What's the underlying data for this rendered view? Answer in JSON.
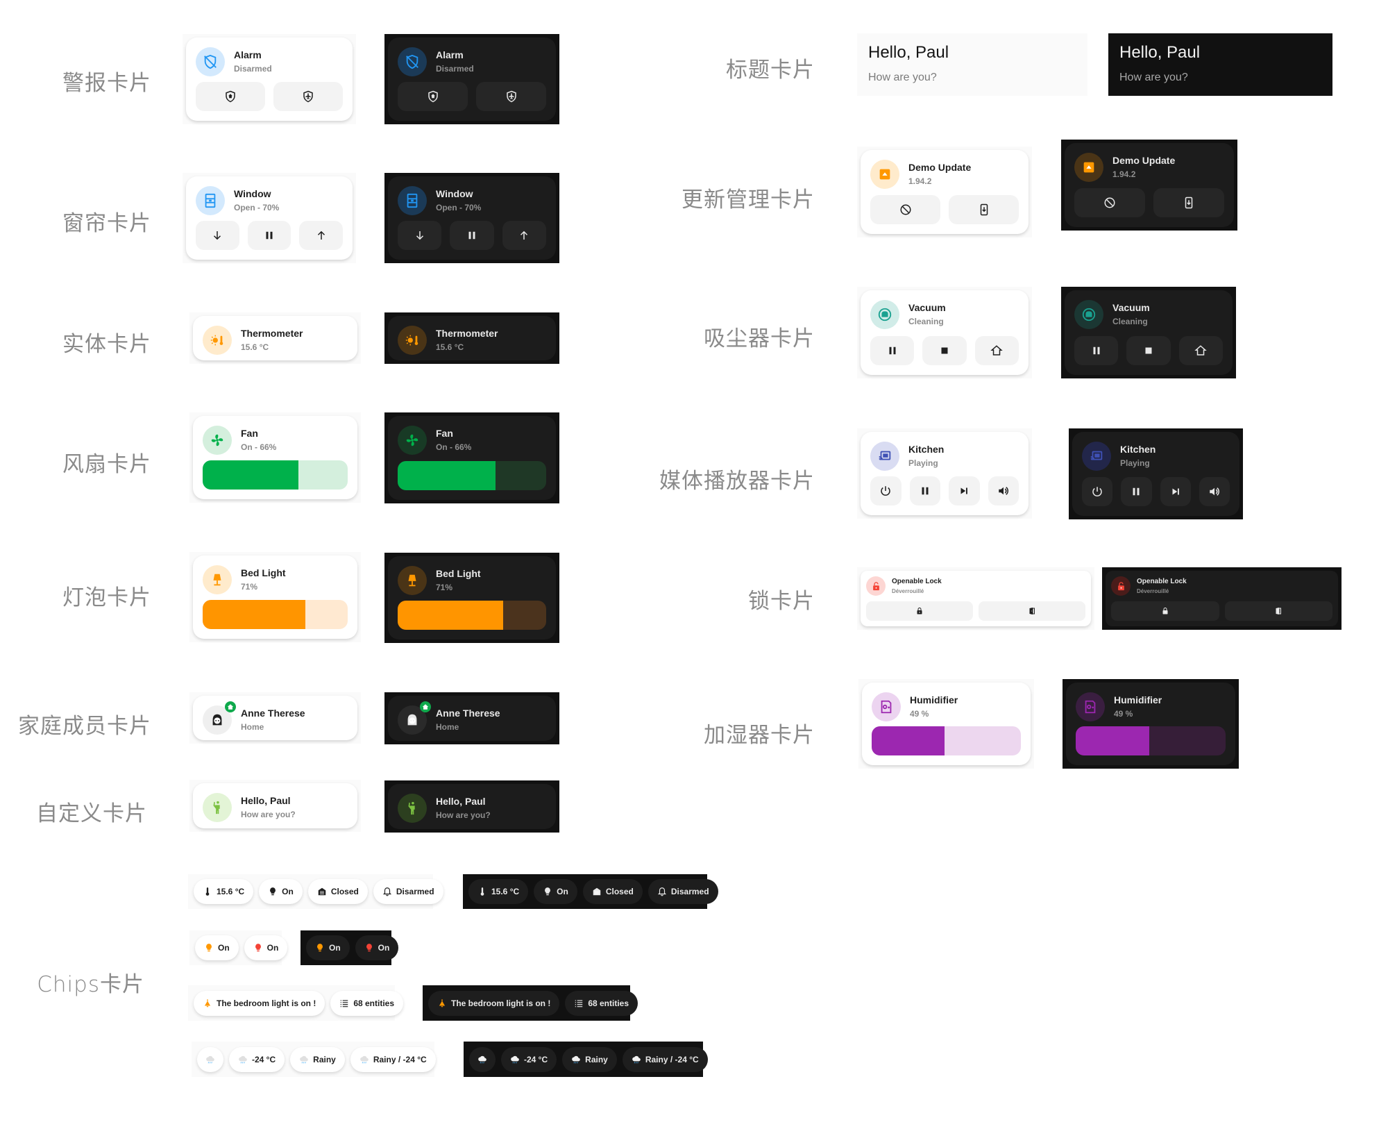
{
  "labels": {
    "alarm": "警报卡片",
    "cover": "窗帘卡片",
    "entity": "实体卡片",
    "fan": "风扇卡片",
    "light": "灯泡卡片",
    "person": "家庭成员卡片",
    "template": "自定义卡片",
    "chips": "Chips卡片",
    "title": "标题卡片",
    "update": "更新管理卡片",
    "vacuum": "吸尘器卡片",
    "media": "媒体播放器卡片",
    "lock": "锁卡片",
    "humidifier": "加湿器卡片"
  },
  "colors": {
    "alarm_blue": "#2196f3",
    "orange": "#ff9800",
    "green": "#00b14b",
    "teal": "#1aa190",
    "indigo": "#3f51b5",
    "red": "#f44336",
    "purple": "#9c27b0",
    "lightgreen": "#7cc142"
  },
  "alarm": {
    "name": "Alarm",
    "state": "Disarmed",
    "icon": "shield-off-icon",
    "buttons": [
      "shield-home-icon",
      "shield-airplane-icon"
    ]
  },
  "cover": {
    "name": "Window",
    "state": "Open - 70%",
    "icon": "window-icon",
    "buttons": [
      "arrow-down-icon",
      "pause-icon",
      "arrow-up-icon"
    ]
  },
  "entity": {
    "name": "Thermometer",
    "state": "15.6 °C",
    "icon": "thermometer-sun-icon"
  },
  "fan": {
    "name": "Fan",
    "state": "On - 66%",
    "icon": "fan-icon",
    "percentage": 66
  },
  "light": {
    "name": "Bed Light",
    "state": "71%",
    "icon": "lamp-icon",
    "brightness": 71
  },
  "person": {
    "name": "Anne Therese",
    "state": "Home",
    "icon": "face-woman-icon",
    "badge": "home-icon"
  },
  "template": {
    "name": "Hello, Paul",
    "state": "How are you?",
    "icon": "human-greeting-icon"
  },
  "title": {
    "title": "Hello, Paul",
    "subtitle": "How are you?"
  },
  "update": {
    "name": "Demo Update",
    "state": "1.94.2",
    "icon": "package-up-icon",
    "buttons": [
      "cancel-icon",
      "cellphone-arrow-down-icon"
    ]
  },
  "vacuum": {
    "name": "Vacuum",
    "state": "Cleaning",
    "icon": "robot-vacuum-icon",
    "buttons": [
      "pause-icon",
      "stop-icon",
      "home-map-marker-icon"
    ]
  },
  "media": {
    "name": "Kitchen",
    "state": "Playing",
    "icon": "cast-icon",
    "buttons": [
      "power-icon",
      "pause-icon",
      "skip-next-icon",
      "volume-icon"
    ]
  },
  "lock": {
    "name": "Openable Lock",
    "state": "Déverrouillé",
    "icon": "lock-open-icon",
    "buttons": [
      "lock-icon",
      "door-open-icon"
    ]
  },
  "humidifier": {
    "name": "Humidifier",
    "state": "49 %",
    "icon": "air-humidifier-icon",
    "humidity": 49
  },
  "chips": {
    "row1": [
      {
        "icon": "thermometer-icon",
        "label": "15.6 °C"
      },
      {
        "icon": "lightbulb-icon",
        "label": "On"
      },
      {
        "icon": "garage-icon",
        "label": "Closed"
      },
      {
        "icon": "bell-icon",
        "label": "Disarmed"
      }
    ],
    "row2": [
      {
        "icon": "lightbulb-orange-icon",
        "label": "On"
      },
      {
        "icon": "lightbulb-red-icon",
        "label": "On"
      }
    ],
    "row3": [
      {
        "icon": "ceiling-light-icon",
        "label": "The bedroom light is on !"
      },
      {
        "icon": "list-icon",
        "label": "68 entities"
      }
    ],
    "row4": [
      {
        "icon": "weather-rainy-icon",
        "label": ""
      },
      {
        "icon": "weather-rainy-icon",
        "label": "-24 °C"
      },
      {
        "icon": "weather-rainy-icon",
        "label": "Rainy"
      },
      {
        "icon": "weather-rainy-icon",
        "label": "Rainy / -24 °C"
      }
    ]
  }
}
